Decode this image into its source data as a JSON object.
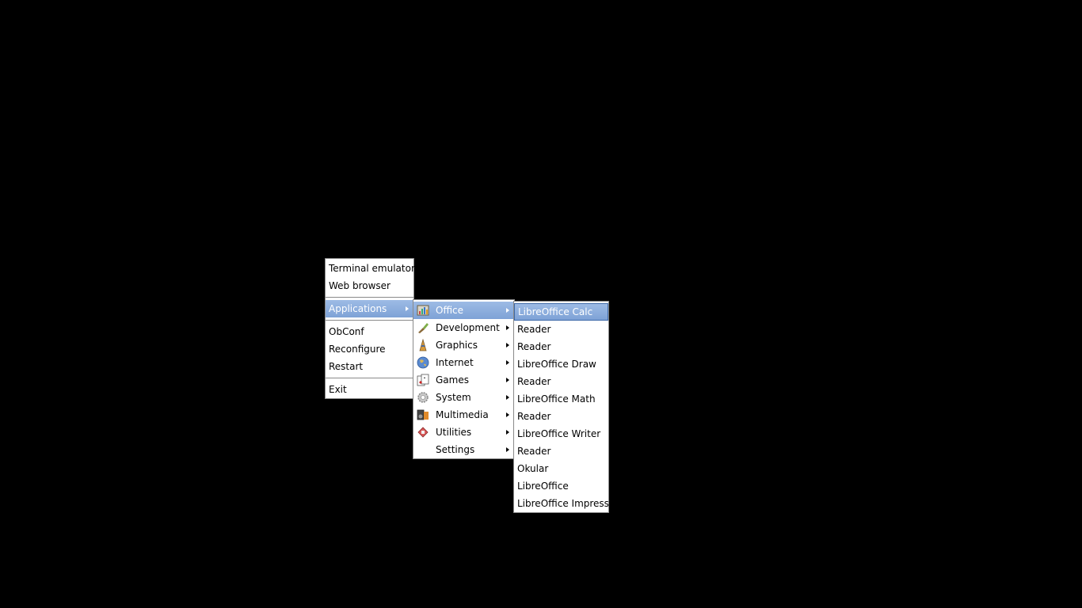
{
  "root_menu": {
    "items": [
      {
        "label": "Terminal emulator"
      },
      {
        "label": "Web browser"
      },
      {
        "label": "Applications"
      },
      {
        "label": "ObConf"
      },
      {
        "label": "Reconfigure"
      },
      {
        "label": "Restart"
      },
      {
        "label": "Exit"
      }
    ]
  },
  "applications_menu": {
    "items": [
      {
        "label": "Office",
        "icon": "office-icon"
      },
      {
        "label": "Development",
        "icon": "development-icon"
      },
      {
        "label": "Graphics",
        "icon": "graphics-icon"
      },
      {
        "label": "Internet",
        "icon": "internet-globe-icon"
      },
      {
        "label": "Games",
        "icon": "games-cards-icon"
      },
      {
        "label": "System",
        "icon": "system-gear-icon"
      },
      {
        "label": "Multimedia",
        "icon": "multimedia-icon"
      },
      {
        "label": "Utilities",
        "icon": "utilities-icon"
      },
      {
        "label": "Settings"
      }
    ]
  },
  "office_menu": {
    "items": [
      {
        "label": "LibreOffice Calc"
      },
      {
        "label": "Reader"
      },
      {
        "label": "Reader"
      },
      {
        "label": "LibreOffice Draw"
      },
      {
        "label": "Reader"
      },
      {
        "label": "LibreOffice Math"
      },
      {
        "label": "Reader"
      },
      {
        "label": "LibreOffice Writer"
      },
      {
        "label": "Reader"
      },
      {
        "label": "Okular"
      },
      {
        "label": "LibreOffice"
      },
      {
        "label": "LibreOffice Impress"
      }
    ]
  },
  "colors": {
    "background": "#000000",
    "menu_bg": "#ffffff",
    "selection": "#7ea2d6",
    "border": "#8a8a8a"
  }
}
